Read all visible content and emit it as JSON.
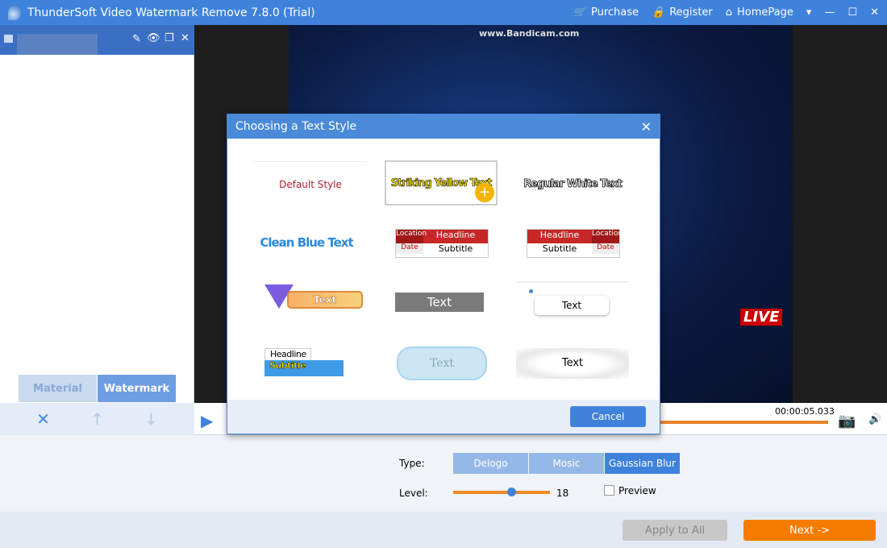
{
  "app": {
    "title": "ThunderSoft Video Watermark Remove 7.8.0 (Trial)",
    "purchase": "Purchase",
    "register": "Register",
    "homepage": "HomePage"
  },
  "left": {
    "tabs": [
      {
        "label": "Material"
      },
      {
        "label": "Watermark",
        "active": true
      }
    ]
  },
  "video": {
    "overlay_text": "www.Bandicam.com",
    "live_badge": "LIVE",
    "time": "00:00:05.033"
  },
  "dialog": {
    "title": "Choosing a Text Style",
    "cancel": "Cancel",
    "styles": {
      "default": "Default Style",
      "yellow": "Striking Yellow Text",
      "white": "Regular White Text",
      "blue": "Clean Blue Text",
      "location": "Location",
      "headline": "Headline",
      "date": "Date",
      "subtitle": "Subtitle",
      "text": "Text"
    }
  },
  "settings": {
    "type_label": "Type:",
    "types": [
      "Delogo",
      "Mosic",
      "Gaussian Blur"
    ],
    "selected_type": "Gaussian Blur",
    "level_label": "Level:",
    "level": 18,
    "level_max": 30,
    "preview_label": "Preview",
    "preview_checked": false
  },
  "footer": {
    "apply_all": "Apply to All",
    "next": "Next ->"
  },
  "colors": {
    "accent": "#3f82dc",
    "orange": "#f57c00"
  }
}
